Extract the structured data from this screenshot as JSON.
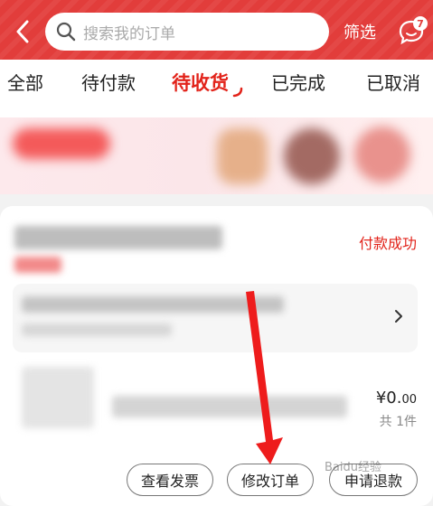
{
  "header": {
    "search_placeholder": "搜索我的订单",
    "filter_label": "筛选",
    "message_badge": "7"
  },
  "tabs": [
    {
      "label": "全部",
      "active": false
    },
    {
      "label": "待付款",
      "active": false
    },
    {
      "label": "待收货",
      "active": true
    },
    {
      "label": "已完成",
      "active": false
    },
    {
      "label": "已取消",
      "active": false
    }
  ],
  "order": {
    "status": "付款成功",
    "price_main": "¥0.",
    "price_cents": "00",
    "quantity": "共 1件",
    "buttons": {
      "invoice": "查看发票",
      "modify": "修改订单",
      "refund": "申请退款"
    }
  },
  "watermark": "Baidu经验",
  "colors": {
    "brand_red": "#e23d3b",
    "active_tab": "#e2231a",
    "arrow": "#ee1c1c"
  }
}
